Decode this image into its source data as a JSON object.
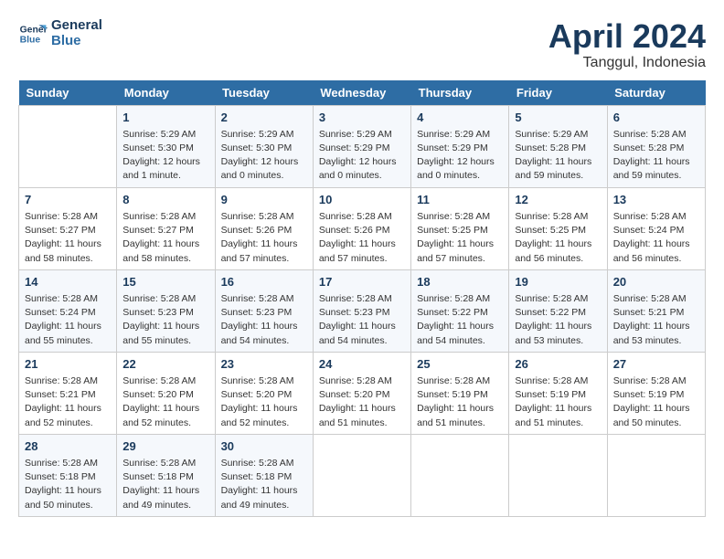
{
  "header": {
    "logo_line1": "General",
    "logo_line2": "Blue",
    "month": "April 2024",
    "location": "Tanggul, Indonesia"
  },
  "weekdays": [
    "Sunday",
    "Monday",
    "Tuesday",
    "Wednesday",
    "Thursday",
    "Friday",
    "Saturday"
  ],
  "weeks": [
    [
      {
        "day": "",
        "info": ""
      },
      {
        "day": "1",
        "info": "Sunrise: 5:29 AM\nSunset: 5:30 PM\nDaylight: 12 hours\nand 1 minute."
      },
      {
        "day": "2",
        "info": "Sunrise: 5:29 AM\nSunset: 5:30 PM\nDaylight: 12 hours\nand 0 minutes."
      },
      {
        "day": "3",
        "info": "Sunrise: 5:29 AM\nSunset: 5:29 PM\nDaylight: 12 hours\nand 0 minutes."
      },
      {
        "day": "4",
        "info": "Sunrise: 5:29 AM\nSunset: 5:29 PM\nDaylight: 12 hours\nand 0 minutes."
      },
      {
        "day": "5",
        "info": "Sunrise: 5:29 AM\nSunset: 5:28 PM\nDaylight: 11 hours\nand 59 minutes."
      },
      {
        "day": "6",
        "info": "Sunrise: 5:28 AM\nSunset: 5:28 PM\nDaylight: 11 hours\nand 59 minutes."
      }
    ],
    [
      {
        "day": "7",
        "info": "Sunrise: 5:28 AM\nSunset: 5:27 PM\nDaylight: 11 hours\nand 58 minutes."
      },
      {
        "day": "8",
        "info": "Sunrise: 5:28 AM\nSunset: 5:27 PM\nDaylight: 11 hours\nand 58 minutes."
      },
      {
        "day": "9",
        "info": "Sunrise: 5:28 AM\nSunset: 5:26 PM\nDaylight: 11 hours\nand 57 minutes."
      },
      {
        "day": "10",
        "info": "Sunrise: 5:28 AM\nSunset: 5:26 PM\nDaylight: 11 hours\nand 57 minutes."
      },
      {
        "day": "11",
        "info": "Sunrise: 5:28 AM\nSunset: 5:25 PM\nDaylight: 11 hours\nand 57 minutes."
      },
      {
        "day": "12",
        "info": "Sunrise: 5:28 AM\nSunset: 5:25 PM\nDaylight: 11 hours\nand 56 minutes."
      },
      {
        "day": "13",
        "info": "Sunrise: 5:28 AM\nSunset: 5:24 PM\nDaylight: 11 hours\nand 56 minutes."
      }
    ],
    [
      {
        "day": "14",
        "info": "Sunrise: 5:28 AM\nSunset: 5:24 PM\nDaylight: 11 hours\nand 55 minutes."
      },
      {
        "day": "15",
        "info": "Sunrise: 5:28 AM\nSunset: 5:23 PM\nDaylight: 11 hours\nand 55 minutes."
      },
      {
        "day": "16",
        "info": "Sunrise: 5:28 AM\nSunset: 5:23 PM\nDaylight: 11 hours\nand 54 minutes."
      },
      {
        "day": "17",
        "info": "Sunrise: 5:28 AM\nSunset: 5:23 PM\nDaylight: 11 hours\nand 54 minutes."
      },
      {
        "day": "18",
        "info": "Sunrise: 5:28 AM\nSunset: 5:22 PM\nDaylight: 11 hours\nand 54 minutes."
      },
      {
        "day": "19",
        "info": "Sunrise: 5:28 AM\nSunset: 5:22 PM\nDaylight: 11 hours\nand 53 minutes."
      },
      {
        "day": "20",
        "info": "Sunrise: 5:28 AM\nSunset: 5:21 PM\nDaylight: 11 hours\nand 53 minutes."
      }
    ],
    [
      {
        "day": "21",
        "info": "Sunrise: 5:28 AM\nSunset: 5:21 PM\nDaylight: 11 hours\nand 52 minutes."
      },
      {
        "day": "22",
        "info": "Sunrise: 5:28 AM\nSunset: 5:20 PM\nDaylight: 11 hours\nand 52 minutes."
      },
      {
        "day": "23",
        "info": "Sunrise: 5:28 AM\nSunset: 5:20 PM\nDaylight: 11 hours\nand 52 minutes."
      },
      {
        "day": "24",
        "info": "Sunrise: 5:28 AM\nSunset: 5:20 PM\nDaylight: 11 hours\nand 51 minutes."
      },
      {
        "day": "25",
        "info": "Sunrise: 5:28 AM\nSunset: 5:19 PM\nDaylight: 11 hours\nand 51 minutes."
      },
      {
        "day": "26",
        "info": "Sunrise: 5:28 AM\nSunset: 5:19 PM\nDaylight: 11 hours\nand 51 minutes."
      },
      {
        "day": "27",
        "info": "Sunrise: 5:28 AM\nSunset: 5:19 PM\nDaylight: 11 hours\nand 50 minutes."
      }
    ],
    [
      {
        "day": "28",
        "info": "Sunrise: 5:28 AM\nSunset: 5:18 PM\nDaylight: 11 hours\nand 50 minutes."
      },
      {
        "day": "29",
        "info": "Sunrise: 5:28 AM\nSunset: 5:18 PM\nDaylight: 11 hours\nand 49 minutes."
      },
      {
        "day": "30",
        "info": "Sunrise: 5:28 AM\nSunset: 5:18 PM\nDaylight: 11 hours\nand 49 minutes."
      },
      {
        "day": "",
        "info": ""
      },
      {
        "day": "",
        "info": ""
      },
      {
        "day": "",
        "info": ""
      },
      {
        "day": "",
        "info": ""
      }
    ]
  ]
}
